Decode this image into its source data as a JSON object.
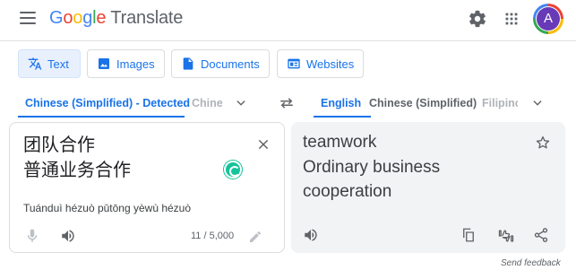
{
  "header": {
    "logo_letters": [
      "G",
      "o",
      "o",
      "g",
      "l",
      "e"
    ],
    "product": "Translate",
    "avatar_letter": "A",
    "icons": [
      "menu-icon",
      "settings-gear-icon",
      "apps-grid-icon"
    ]
  },
  "modes": [
    {
      "label": "Text",
      "icon": "translate-icon",
      "active": true
    },
    {
      "label": "Images",
      "icon": "image-icon",
      "active": false
    },
    {
      "label": "Documents",
      "icon": "document-icon",
      "active": false
    },
    {
      "label": "Websites",
      "icon": "website-icon",
      "active": false
    }
  ],
  "source_langs": {
    "detected": "Chinese (Simplified) - Detected",
    "truncated": "Chine"
  },
  "target_langs": {
    "selected": "English",
    "second": "Chinese (Simplified)",
    "truncated": "Filipino"
  },
  "source": {
    "line1": "团队合作",
    "line2": "普通业务合作",
    "romanization": "Tuánduì hézuò pǔtōng yèwù hézuò",
    "char_count": "11 / 5,000"
  },
  "target": {
    "line1": "teamwork",
    "line2": "Ordinary business",
    "line3": "cooperation"
  },
  "footer": {
    "send_feedback": "Send feedback"
  },
  "colors": {
    "accent": "#1a73e8",
    "avatar_bg": "#673ab7",
    "grammarly": "#15c39a"
  }
}
